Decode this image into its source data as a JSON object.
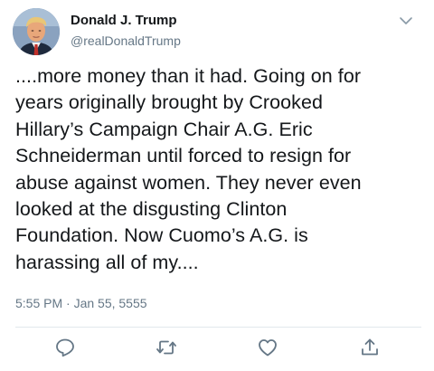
{
  "tweet": {
    "author": {
      "display_name": "Donald J. Trump",
      "handle": "@realDonaldTrump",
      "avatar_icon": "profile-photo"
    },
    "text": "....more money than it had. Going on for\nyears originally brought by Crooked\nHillary’s Campaign Chair A.G. Eric\nSchneiderman until forced to resign for\nabuse against women. They never even\nlooked at the disgusting Clinton\nFoundation. Now Cuomo’s A.G. is\nharassing all of my....",
    "timestamp": "5:55 PM · Jan 55, 5555",
    "menu_icon": "chevron-down-icon",
    "actions": [
      {
        "name": "reply",
        "icon": "reply-icon"
      },
      {
        "name": "retweet",
        "icon": "retweet-icon"
      },
      {
        "name": "like",
        "icon": "heart-icon"
      },
      {
        "name": "share",
        "icon": "share-icon"
      }
    ]
  },
  "colors": {
    "text_primary": "#14171a",
    "text_secondary": "#657786",
    "divider": "#e1e8ed",
    "icon": "#657786"
  }
}
